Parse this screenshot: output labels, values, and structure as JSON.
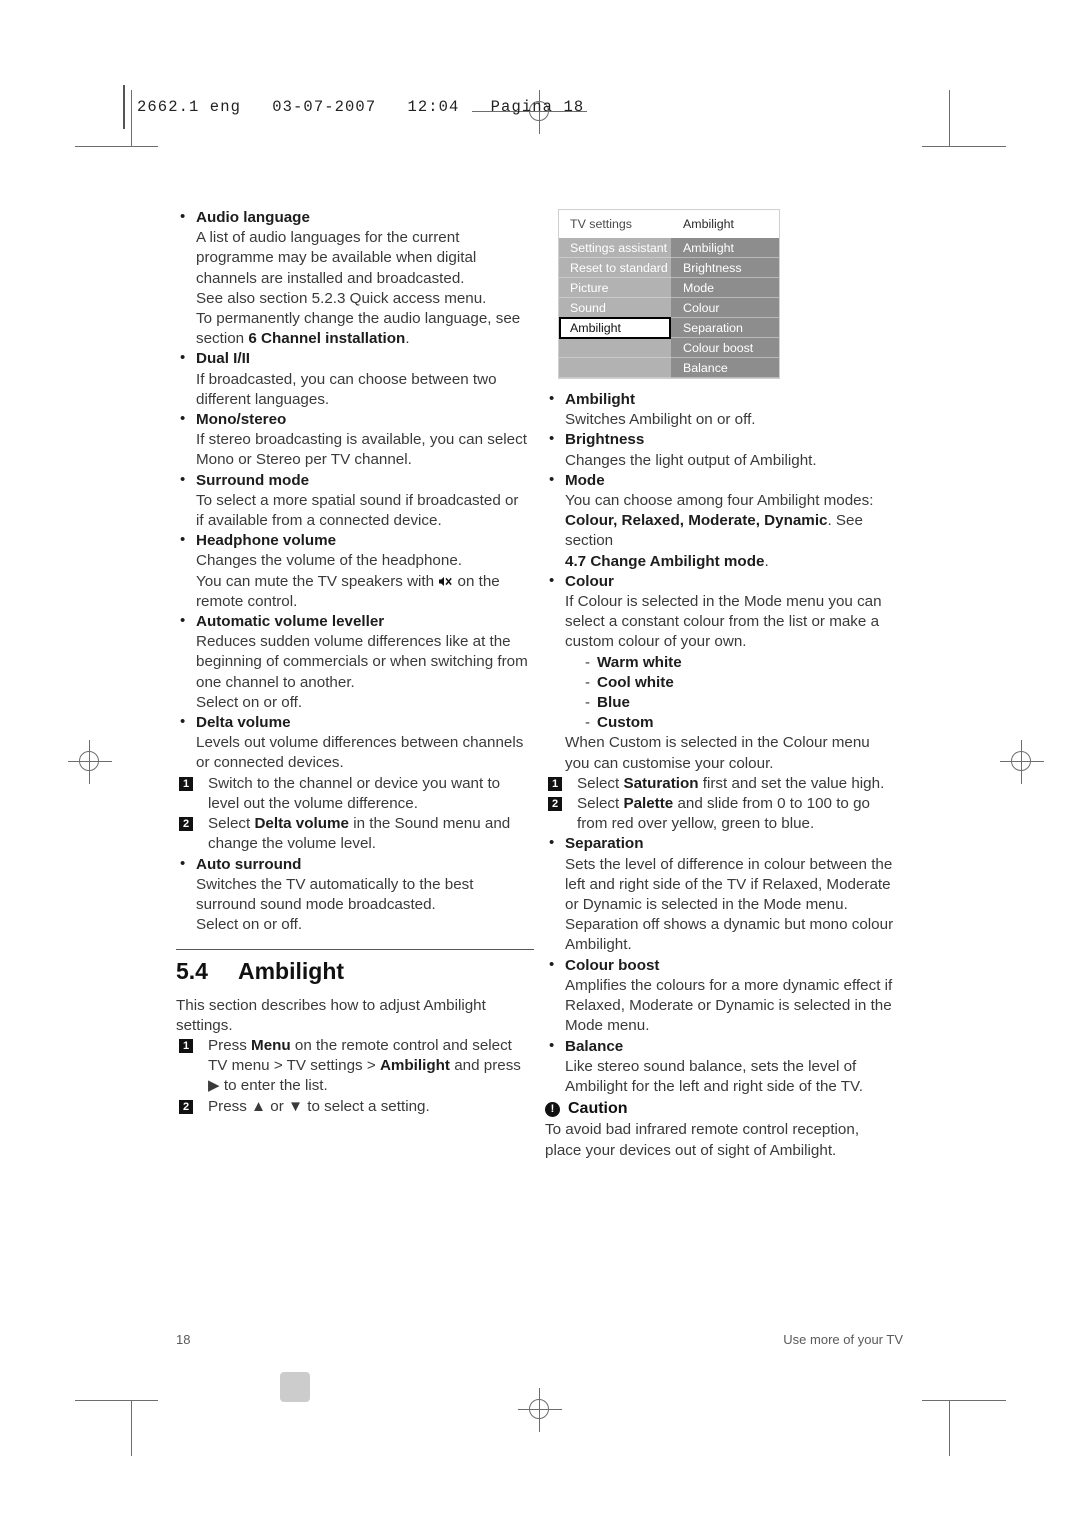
{
  "slug": {
    "text": "2662.1 eng   03-07-2007   12:04   Pagina 18"
  },
  "left_column": {
    "items": [
      {
        "heading": "Audio language",
        "lines": [
          "A list of audio languages for the current",
          "programme may be available when digital",
          "channels are installed and broadcasted.",
          "See also section 5.2.3 Quick access menu.",
          "To permanently change the audio language, see"
        ],
        "last_line_prefix": "section ",
        "last_line_bold": "6 Channel installation",
        "last_line_suffix": "."
      },
      {
        "heading": "Dual I/II",
        "lines": [
          "If broadcasted, you can choose between two",
          "different languages."
        ]
      },
      {
        "heading": "Mono/stereo",
        "lines": [
          "If stereo broadcasting is available, you can select",
          "Mono or Stereo per TV channel."
        ]
      },
      {
        "heading": "Surround mode",
        "lines": [
          "To select a more spatial sound if broadcasted or",
          "if available from a connected device."
        ]
      },
      {
        "heading": "Headphone volume",
        "lines": [
          "Changes the volume of the headphone."
        ],
        "mute_line_prefix": "You can mute the TV speakers with ",
        "mute_line_suffix": " on the",
        "mute_icon": "mute-speaker-icon",
        "lines_after": [
          "remote control."
        ]
      },
      {
        "heading": "Automatic volume leveller",
        "lines": [
          "Reduces sudden volume differences like at the",
          "beginning of commercials or when switching from",
          "one channel to another.",
          "Select on or off."
        ]
      },
      {
        "heading": "Delta volume",
        "lines": [
          "Levels out volume differences between channels",
          "or connected devices."
        ]
      }
    ],
    "delta_steps": [
      {
        "num": "1",
        "line1": "Switch to the channel or device you want to",
        "line2": "level out the volume difference."
      },
      {
        "num": "2",
        "pre": "Select ",
        "bold": "Delta volume",
        "post": " in the Sound menu and",
        "line2": "change the volume level."
      }
    ],
    "auto_surround": {
      "heading": "Auto surround",
      "lines": [
        "Switches the TV automatically to the best",
        "surround sound mode broadcasted.",
        "Select on or off."
      ]
    },
    "section": {
      "number": "5.4",
      "title": "Ambilight",
      "intro": [
        "This section describes how to adjust Ambilight",
        "settings."
      ],
      "steps": [
        {
          "num": "1",
          "pre": "Press ",
          "bold1": "Menu",
          "mid": " on the remote control and select",
          "line2_pre": "TV menu > TV settings > ",
          "line2_bold": "Ambilight",
          "line2_post": " and press",
          "line3": "▶ to enter the list."
        },
        {
          "num": "2",
          "full": "Press ▲ or ▼ to select a setting."
        }
      ]
    }
  },
  "tv_menu": {
    "header_left": "TV settings",
    "header_right": "Ambilight",
    "left_items": [
      {
        "label": "Settings assistant",
        "selected": false
      },
      {
        "label": "Reset to standard",
        "selected": false
      },
      {
        "label": "Picture",
        "selected": false
      },
      {
        "label": "Sound",
        "selected": false
      },
      {
        "label": "Ambilight",
        "selected": true
      },
      {
        "label": "",
        "selected": false
      },
      {
        "label": "",
        "selected": false
      }
    ],
    "right_items": [
      {
        "label": "Ambilight"
      },
      {
        "label": "Brightness"
      },
      {
        "label": "Mode"
      },
      {
        "label": "Colour"
      },
      {
        "label": "Separation"
      },
      {
        "label": "Colour boost"
      },
      {
        "label": "Balance"
      }
    ],
    "colors": {
      "left_column_bg": "#b2b2b2",
      "right_column_bg": "#8d8d8d",
      "header_bg": "#ffffff",
      "selected_bg": "#ffffff",
      "selected_border": "#000000",
      "item_text": "#ffffff"
    }
  },
  "right_column": {
    "items": [
      {
        "heading": "Ambilight",
        "lines": [
          "Switches Ambilight on or off."
        ]
      },
      {
        "heading": "Brightness",
        "lines": [
          "Changes the light output of Ambilight."
        ]
      },
      {
        "heading": "Mode",
        "lines": [
          "You can choose among four Ambilight modes:"
        ],
        "mode_bold": "Colour, Relaxed, Moderate, Dynamic",
        "mode_post": ". See section",
        "mode_line3_bold": "4.7 Change Ambilight mode",
        "mode_line3_post": "."
      },
      {
        "heading": "Colour",
        "lines": [
          "If Colour is selected in the Mode menu you can",
          "select a constant colour from the list or make a",
          "custom colour of your own."
        ],
        "sub_items": [
          "Warm white",
          "Cool white",
          "Blue",
          "Custom"
        ],
        "after_lines": [
          "When Custom is selected in the Colour menu",
          "you can customise your colour."
        ],
        "steps": [
          {
            "num": "1",
            "pre": "Select ",
            "bold": "Saturation",
            "post": " first and set the value high."
          },
          {
            "num": "2",
            "pre": "Select ",
            "bold": "Palette",
            "post": " and slide from 0 to 100 to go",
            "line2": "from red over yellow, green to blue."
          }
        ]
      },
      {
        "heading": "Separation",
        "lines": [
          "Sets the level of difference in colour between the",
          "left and right side of the TV if Relaxed, Moderate",
          "or Dynamic is selected in the Mode menu.",
          "Separation off shows a dynamic but mono colour",
          "Ambilight."
        ]
      },
      {
        "heading": "Colour boost",
        "lines": [
          "Amplifies the colours for a more dynamic effect if",
          "Relaxed, Moderate or Dynamic is selected in the",
          "Mode menu."
        ]
      },
      {
        "heading": "Balance",
        "lines": [
          "Like stereo sound balance, sets the level of",
          "Ambilight for the left and right side of the TV."
        ]
      }
    ],
    "caution": {
      "icon": "exclamation-icon",
      "title": "Caution",
      "lines": [
        "To avoid bad infrared remote control reception,",
        "place your devices out of sight of Ambilight."
      ]
    }
  },
  "footer": {
    "page_number": "18",
    "running_title": "Use more of your TV"
  }
}
